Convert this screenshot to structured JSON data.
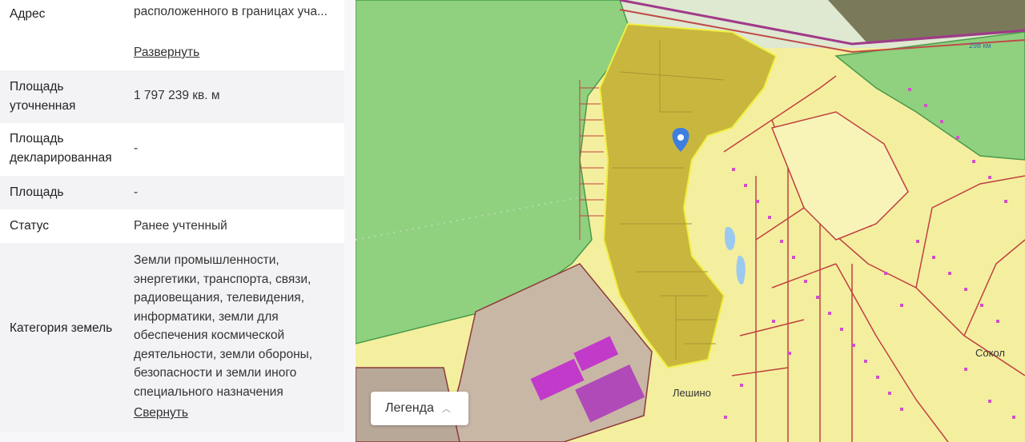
{
  "info": {
    "rows": [
      {
        "label": "Адрес",
        "value": "расположенного в границах уча...",
        "link": "Развернуть"
      },
      {
        "label": "Площадь уточненная",
        "value": "1 797 239 кв. м"
      },
      {
        "label": "Площадь декларированная",
        "value": "-"
      },
      {
        "label": "Площадь",
        "value": "-"
      },
      {
        "label": "Статус",
        "value": "Ранее учтенный"
      },
      {
        "label": "Категория земель",
        "value": "Земли промышленности, энергетики, транспорта, связи, радиовещания, телевидения, информатики, земли для обеспечения космической деятельности, земли обороны, безопасности и земли иного специального назначения",
        "link": "Свернуть"
      }
    ]
  },
  "map": {
    "legend_button": "Легенда",
    "place_label": "Лешино",
    "place_label_2": "Сокол",
    "km_label": "298 км",
    "colors": {
      "forest": "#8fd17e",
      "residential": "#f3ee9c",
      "selected_parcel": "#c9b63f",
      "parcel_border": "#b23a3a",
      "buildings": "#c23ac9",
      "industrial": "#c9b7a5",
      "marker": "#3d7fe0"
    }
  }
}
